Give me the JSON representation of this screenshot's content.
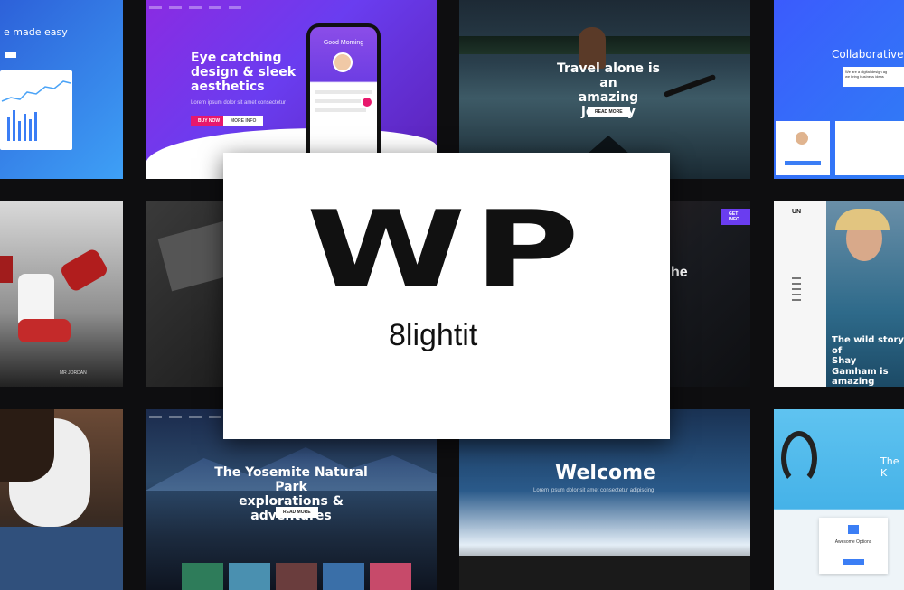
{
  "tiles": {
    "t1": {
      "headline": "e made easy"
    },
    "t2": {
      "headline_lines": [
        "Eye catching",
        "design & sleek",
        "aesthetics"
      ],
      "phone_greeting": "Good Morning",
      "btn_primary": "BUY NOW",
      "btn_secondary": "MORE INFO"
    },
    "t3": {
      "headline_lines": [
        "Travel alone is an",
        "amazing journey"
      ],
      "button": "READ MORE"
    },
    "t4": {
      "headline": "Collaborative",
      "sub_lines": [
        "We are a digital design ag",
        "we bring business ideas"
      ]
    },
    "t5": {
      "caption": "MR JORDAN"
    },
    "t7": {
      "fragment": "he",
      "pill": "GET INFO"
    },
    "t8": {
      "logo": "UN",
      "headline_lines": [
        "The wild story of",
        "Shay Gamham is",
        "amazing"
      ]
    },
    "t10": {
      "headline_lines": [
        "The Yosemite Natural Park",
        "explorations & adventures"
      ],
      "button": "READ MORE"
    },
    "t11": {
      "headline": "Welcome"
    },
    "t12": {
      "headline": "The K",
      "box_title": "Awesome Options"
    }
  },
  "card": {
    "logo_text": "WP",
    "brand": "8lightit"
  },
  "colors": {
    "accent_pink": "#e8186c",
    "purple": "#6a3df0",
    "card_bg": "#ffffff"
  }
}
